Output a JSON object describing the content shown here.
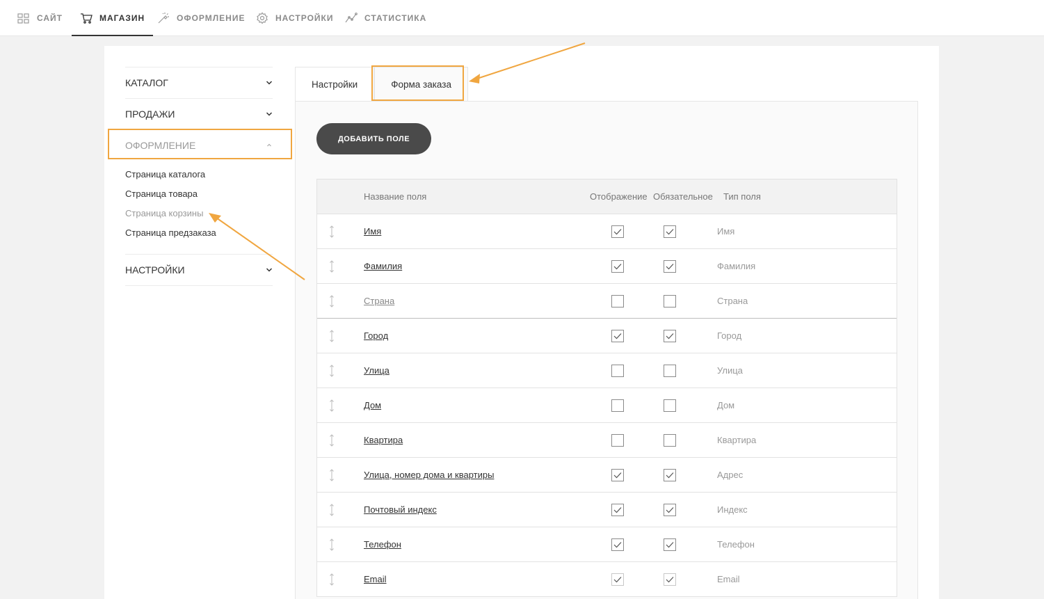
{
  "topnav": {
    "items": [
      {
        "label": "САЙТ",
        "icon": "grid-icon"
      },
      {
        "label": "МАГАЗИН",
        "icon": "cart-icon",
        "active": true
      },
      {
        "label": "ОФОРМЛЕНИЕ",
        "icon": "magic-wand-icon"
      },
      {
        "label": "НАСТРОЙКИ",
        "icon": "gear-icon"
      },
      {
        "label": "СТАТИСТИКА",
        "icon": "chart-line-icon"
      }
    ]
  },
  "sidebar": {
    "sections": [
      {
        "label": "КАТАЛОГ"
      },
      {
        "label": "ПРОДАЖИ"
      },
      {
        "label": "ОФОРМЛЕНИЕ",
        "expanded": true,
        "items": [
          "Страница каталога",
          "Страница товара",
          "Страница корзины",
          "Страница предзаказа"
        ]
      },
      {
        "label": "НАСТРОЙКИ"
      }
    ]
  },
  "tabs": [
    "Настройки",
    "Форма заказа"
  ],
  "panel": {
    "add_button": "ДОБАВИТЬ ПОЛЕ",
    "columns": [
      "Название поля",
      "Отображение",
      "Обязательное",
      "Тип поля"
    ],
    "rows": [
      {
        "name": "Имя",
        "display": true,
        "required": true,
        "type": "Имя"
      },
      {
        "name": "Фамилия",
        "display": true,
        "required": true,
        "type": "Фамилия"
      },
      {
        "name": "Страна",
        "display": false,
        "required": false,
        "type": "Страна"
      },
      {
        "name": "Город",
        "display": true,
        "required": true,
        "type": "Город"
      },
      {
        "name": "Улица",
        "display": false,
        "required": false,
        "type": "Улица"
      },
      {
        "name": "Дом",
        "display": false,
        "required": false,
        "type": "Дом"
      },
      {
        "name": "Квартира",
        "display": false,
        "required": false,
        "type": "Квартира"
      },
      {
        "name": "Улица, номер дома и квартиры",
        "display": true,
        "required": true,
        "type": "Адрес"
      },
      {
        "name": "Почтовый индекс",
        "display": true,
        "required": true,
        "type": "Индекс"
      },
      {
        "name": "Телефон",
        "display": true,
        "required": true,
        "type": "Телефон"
      },
      {
        "name": "Email",
        "display": true,
        "required": true,
        "type": "Email"
      }
    ]
  },
  "colors": {
    "highlight": "#f0a640",
    "button": "#4a4a4a"
  }
}
